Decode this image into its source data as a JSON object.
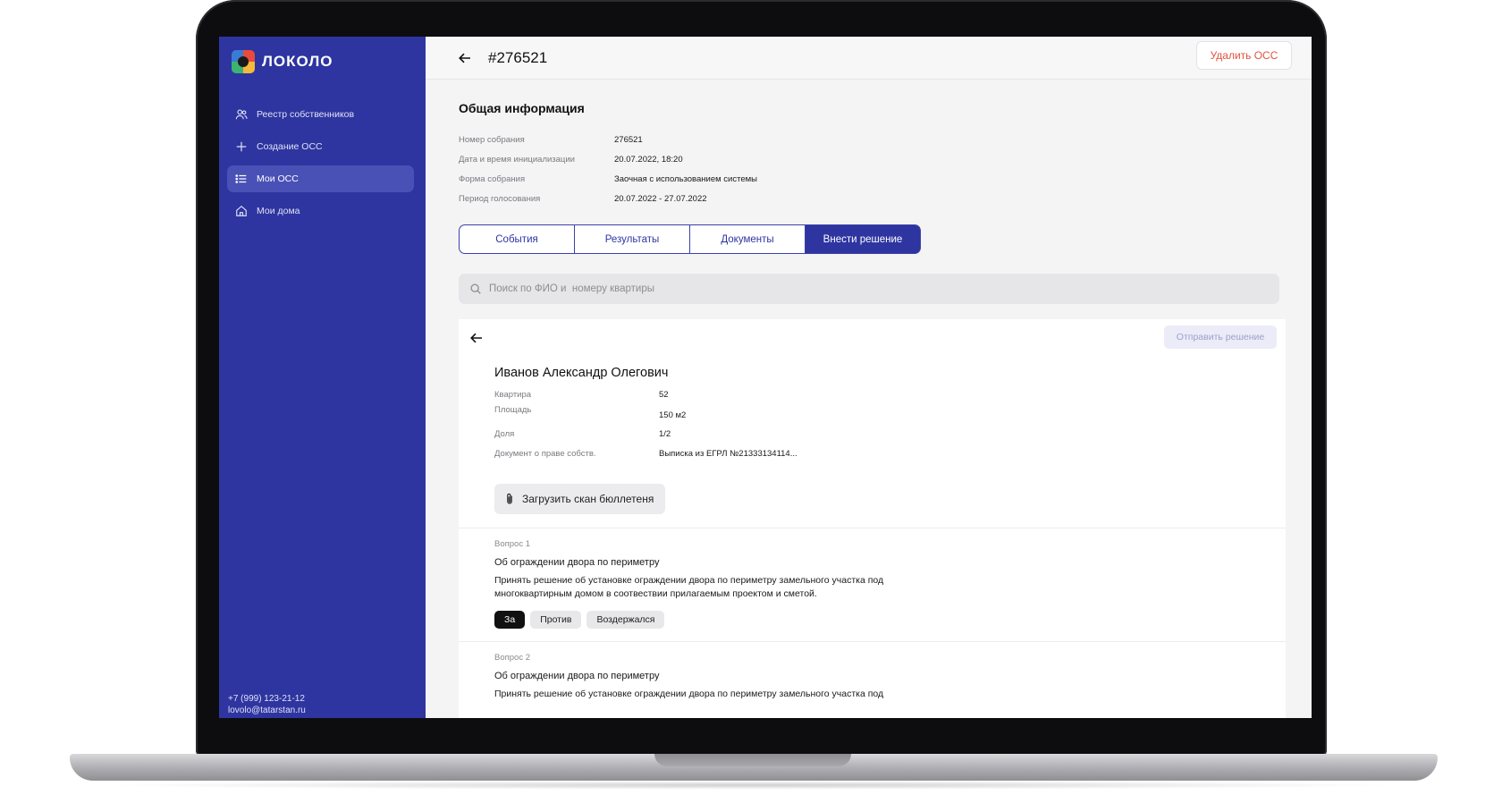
{
  "app": {
    "logo_text": "ЛОКОЛО",
    "brand_color": "#2e35a0",
    "danger_color": "#e0523f"
  },
  "sidebar": {
    "items": [
      {
        "label": "Реестр собственников",
        "icon": "users-icon",
        "active": false
      },
      {
        "label": "Создание ОСС",
        "icon": "plus-icon",
        "active": false
      },
      {
        "label": "Мои ОСС",
        "icon": "list-icon",
        "active": true
      },
      {
        "label": "Мои дома",
        "icon": "home-icon",
        "active": false
      }
    ],
    "phone": "+7 (999) 123-21-12",
    "email": "lovolo@tatarstan.ru"
  },
  "header": {
    "title": "#276521",
    "delete_label": "Удалить ОСС"
  },
  "general": {
    "title": "Общая информация",
    "rows": [
      {
        "label": "Номер собрания",
        "value": "276521"
      },
      {
        "label": "Дата и время инициализации",
        "value": "20.07.2022, 18:20"
      },
      {
        "label": "Форма собрания",
        "value": "Заочная с использованием системы"
      },
      {
        "label": "Период голосования",
        "value": "20.07.2022 - 27.07.2022"
      }
    ]
  },
  "tabs": [
    {
      "label": "События",
      "active": false
    },
    {
      "label": "Результаты",
      "active": false
    },
    {
      "label": "Документы",
      "active": false
    },
    {
      "label": "Внести решение",
      "active": true
    }
  ],
  "search": {
    "placeholder": "Поиск по ФИО и  номеру квартиры",
    "value": ""
  },
  "card": {
    "send_label": "Отправить решение",
    "owner_name": "Иванов Александр Олегович",
    "rows": [
      {
        "label": "Квартира",
        "value": "52"
      },
      {
        "label": "Площадь",
        "value": "150 м2"
      },
      {
        "label": "Доля",
        "value": "1/2"
      },
      {
        "label": "Документ о праве собств.",
        "value": "Выписка из ЕГРЛ №21333134114..."
      }
    ],
    "upload_label": "Загрузить скан бюллетеня"
  },
  "questions": [
    {
      "number": "Вопрос 1",
      "title": "Об ограждении двора по периметру",
      "text": "Принять решение об установке ограждении двора по периметру замельного участка под многоквартирным домом в соотвествии прилагаемым проектом и сметой.",
      "answers": [
        "За",
        "Против",
        "Воздержался"
      ],
      "selected": "За"
    },
    {
      "number": "Вопрос 2",
      "title": "Об ограждении двора по периметру",
      "text": "Принять решение об установке ограждении двора по периметру замельного участка под"
    }
  ]
}
